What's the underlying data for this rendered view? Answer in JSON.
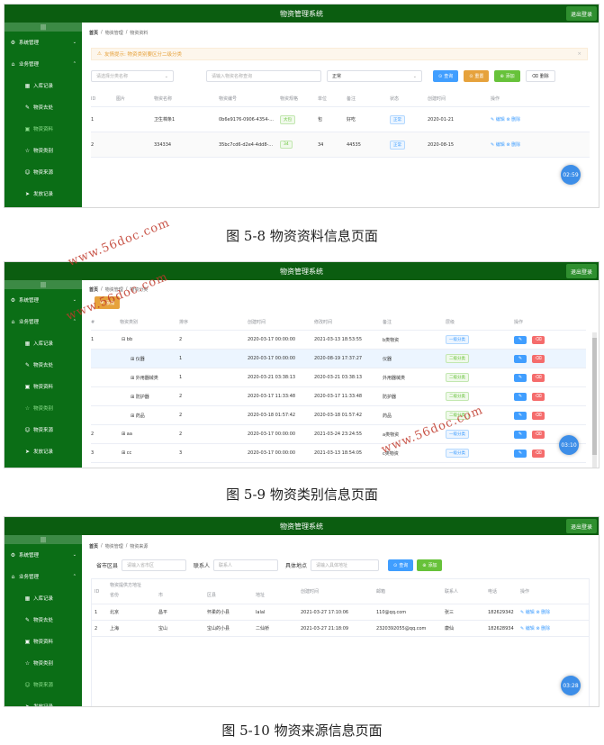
{
  "app_title": "物资管理系统",
  "exit_label": "退出登录",
  "captions": [
    "图 5-8 物资资料信息页面",
    "图 5-9 物资类别信息页面",
    "图 5-10 物资来源信息页面"
  ],
  "watermark": "www.56doc.com",
  "sidebar": {
    "collapse": "|||",
    "system": "系统管理",
    "business": "业务管理",
    "items": [
      "入库记录",
      "物资去处",
      "物资资料",
      "物资类别",
      "物资来源",
      "发放记录"
    ]
  },
  "s1": {
    "breadcrumb": [
      "首页",
      "物资管理",
      "物资资料"
    ],
    "alert": "友情提示: 物资类别要区分二级分类",
    "filter_cat": "请选择分类名称",
    "filter_name": "请输入物资名称查询",
    "filter_state": "正常",
    "btn_query": "查询",
    "btn_reset": "重置",
    "btn_add": "添加",
    "btn_delete": "删除",
    "headers": [
      "ID",
      "图片",
      "物资名称",
      "物资编号",
      "物资规格",
      "单位",
      "备注",
      "状态",
      "创建时间",
      "操作"
    ],
    "rows": [
      {
        "id": "1",
        "img": "",
        "name": "卫生棉条1",
        "code": "0b6e9176-0906-4354-...",
        "spec": "大包",
        "unit": "包",
        "remark": "好吃",
        "status": "正常",
        "time": "2020-01-21",
        "edit": "编辑",
        "del": "删除"
      },
      {
        "id": "2",
        "img": "",
        "name": "334334",
        "code": "35bc7cd6-d2e4-4dd8-...",
        "spec": "34",
        "unit": "34",
        "remark": "44535",
        "status": "正常",
        "time": "2020-08-15",
        "edit": "编辑",
        "del": "删除"
      }
    ],
    "timer": "02:59"
  },
  "s2": {
    "breadcrumb": [
      "首页",
      "物资管理",
      "物资分类"
    ],
    "btn_add": "添加",
    "headers": [
      "#",
      "物资类别",
      "排序",
      "创建时间",
      "修改时间",
      "备注",
      "层级",
      "操作"
    ],
    "rows": [
      {
        "id": "1",
        "name": "bb",
        "sort": "2",
        "ctime": "2020-03-17 00:00:00",
        "mtime": "2021-03-13 18:53:55",
        "remark": "b类物资",
        "level": "一级分类",
        "child": false,
        "expand": "⊟"
      },
      {
        "id": "",
        "name": "仪器",
        "sort": "1",
        "ctime": "2020-03-17 00:00:00",
        "mtime": "2020-08-19 17:37:27",
        "remark": "仪器",
        "level": "二级分类",
        "child": true,
        "expand": "⊞"
      },
      {
        "id": "",
        "name": "外用器械类",
        "sort": "1",
        "ctime": "2020-03-21 03:38:13",
        "mtime": "2020-03-21 03:38:13",
        "remark": "外用器械类",
        "level": "二级分类",
        "child": true,
        "expand": "⊞"
      },
      {
        "id": "",
        "name": "防护器",
        "sort": "2",
        "ctime": "2020-03-17 11:33:48",
        "mtime": "2020-03-17 11:33:48",
        "remark": "防护器",
        "level": "二级分类",
        "child": true,
        "expand": "⊞"
      },
      {
        "id": "",
        "name": "药品",
        "sort": "2",
        "ctime": "2020-03-18 01:57:42",
        "mtime": "2020-03-18 01:57:42",
        "remark": "药品",
        "level": "二级分类",
        "child": true,
        "expand": "⊞"
      },
      {
        "id": "2",
        "name": "aa",
        "sort": "2",
        "ctime": "2020-03-17 00:00:00",
        "mtime": "2021-03-24 23:24:55",
        "remark": "a类物资",
        "level": "一级分类",
        "child": false,
        "expand": "⊞"
      },
      {
        "id": "3",
        "name": "cc",
        "sort": "3",
        "ctime": "2020-03-17 00:00:00",
        "mtime": "2021-03-13 18:54:05",
        "remark": "c类物资",
        "level": "一级分类",
        "child": false,
        "expand": "⊞"
      }
    ],
    "timer": "03:10"
  },
  "s3": {
    "breadcrumb": [
      "首页",
      "物资管理",
      "物资来源"
    ],
    "lbl_area": "省市区县",
    "ph_area": "请输入省市区",
    "lbl_contact": "联系人",
    "ph_contact": "联系人",
    "lbl_addr": "具体地点",
    "ph_addr": "请输入具体地址",
    "btn_query": "查询",
    "btn_add": "添加",
    "group_header": "物资提供方地址",
    "headers": [
      "ID",
      "省份",
      "市",
      "区县",
      "地址",
      "创建时间",
      "邮箱",
      "联系人",
      "电话",
      "操作"
    ],
    "rows": [
      {
        "id": "1",
        "prov": "北京",
        "city": "昌平",
        "district": "怀柔的小县",
        "addr": "lalal",
        "time": "2021-03-27 17:10:06",
        "email": "110@qq.com",
        "contact": "张三",
        "phone": "182629342",
        "edit": "编辑",
        "del": "删除"
      },
      {
        "id": "2",
        "prov": "上海",
        "city": "宝山",
        "district": "宝山的小县",
        "addr": "二仙桥",
        "time": "2021-03-27 21:18:09",
        "email": "2320392055@qq.com",
        "contact": "康仙",
        "phone": "182628934",
        "edit": "编辑",
        "del": "删除"
      }
    ],
    "timer": "03:28"
  }
}
